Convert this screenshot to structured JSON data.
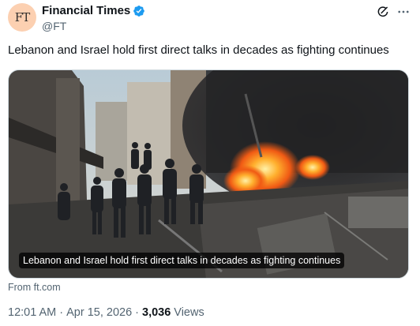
{
  "author": {
    "avatar_text": "FT",
    "display_name": "Financial Times",
    "handle": "@FT",
    "verified_color": "#1d9bf0"
  },
  "tweet": {
    "text": "Lebanon and Israel hold first direct talks in decades as fighting continues"
  },
  "card": {
    "caption": "Lebanon and Israel hold first direct talks in decades as fighting continues",
    "source": "From ft.com"
  },
  "meta": {
    "time": "12:01 AM",
    "date": "Apr 15, 2026",
    "separator": "·",
    "views_count": "3,036",
    "views_label": "Views"
  },
  "icons": {
    "verified": "verified-badge-icon",
    "grok": "grok-icon",
    "more": "more-options-icon"
  }
}
